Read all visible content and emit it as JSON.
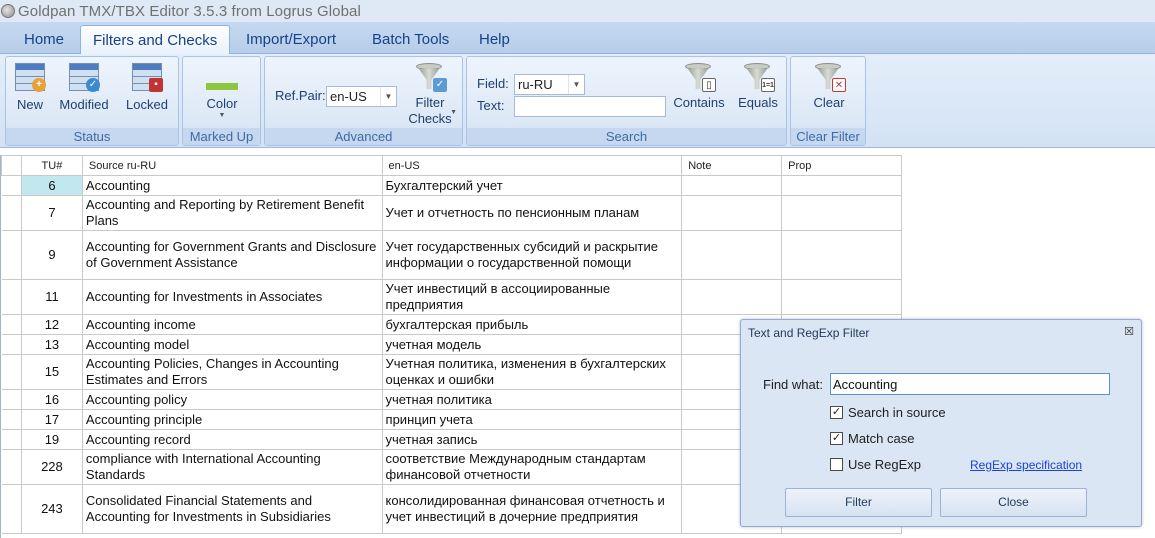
{
  "window": {
    "title": "Goldpan TMX/TBX Editor 3.5.3 from Logrus Global"
  },
  "tabs": [
    {
      "label": "Home"
    },
    {
      "label": "Filters and Checks"
    },
    {
      "label": "Import/Export"
    },
    {
      "label": "Batch Tools"
    },
    {
      "label": "Help"
    }
  ],
  "ribbon": {
    "status": {
      "label": "Status",
      "new": "New",
      "modified": "Modified",
      "locked": "Locked"
    },
    "marked_up": {
      "label": "Marked Up",
      "color": "Color",
      "swatch": "#8dc63f"
    },
    "advanced": {
      "label": "Advanced",
      "refpair_label": "Ref.Pair:",
      "refpair_value": "en-US",
      "filter_checks_1": "Filter",
      "filter_checks_2": "Checks"
    },
    "search": {
      "label": "Search",
      "field_label": "Field:",
      "field_value": "ru-RU",
      "text_label": "Text:",
      "text_value": "",
      "contains": "Contains",
      "equals": "Equals"
    },
    "clear_filter": {
      "label": "Clear Filter",
      "clear": "Clear"
    }
  },
  "grid": {
    "headers": {
      "tu": "TU#",
      "source": "Source ru-RU",
      "target": "en-US",
      "note": "Note",
      "prop": "Prop"
    },
    "rows": [
      {
        "tu": "6",
        "source": "Accounting",
        "target": "Бухгалтерский учет"
      },
      {
        "tu": "7",
        "source": "Accounting and Reporting by Retirement Benefit Plans",
        "target": "Учет и отчетность по пенсионным планам"
      },
      {
        "tu": "9",
        "source": "Accounting for Government Grants and Disclosure of Government Assistance",
        "target": "Учет государственных субсидий и раскрытие информации о государственной помощи"
      },
      {
        "tu": "11",
        "source": "Accounting for Investments in Associates",
        "target": "Учет инвестиций в ассоциированные предприятия"
      },
      {
        "tu": "12",
        "source": "Accounting income",
        "target": "бухгалтерская прибыль"
      },
      {
        "tu": "13",
        "source": "Accounting model",
        "target": "учетная модель"
      },
      {
        "tu": "15",
        "source": "Accounting Policies, Changes in Accounting Estimates and Errors",
        "target": "Учетная политика, изменения в бухгалтерских оценках и ошибки"
      },
      {
        "tu": "16",
        "source": "Accounting policy",
        "target": "учетная политика"
      },
      {
        "tu": "17",
        "source": "Accounting principle",
        "target": "принцип учета"
      },
      {
        "tu": "19",
        "source": "Accounting record",
        "target": "учетная запись"
      },
      {
        "tu": "228",
        "source": "compliance with International Accounting Standards",
        "target": "соответствие Международным стандартам финансовой отчетности"
      },
      {
        "tu": "243",
        "source": "Consolidated Financial Statements and Accounting for Investments in Subsidiaries",
        "target": "консолидированная финансовая отчетность и учет инвестиций в дочерние предприятия"
      }
    ]
  },
  "dialog": {
    "title": "Text and RegExp Filter",
    "close_glyph": "☒",
    "find_label": "Find what:",
    "find_value": "Accounting",
    "search_in_source": {
      "label": "Search in source",
      "checked": true
    },
    "match_case": {
      "label": "Match case",
      "checked": true
    },
    "use_regexp": {
      "label": "Use RegExp",
      "checked": false
    },
    "regexp_link": "RegExp specification",
    "filter_button": "Filter",
    "close_button": "Close"
  }
}
